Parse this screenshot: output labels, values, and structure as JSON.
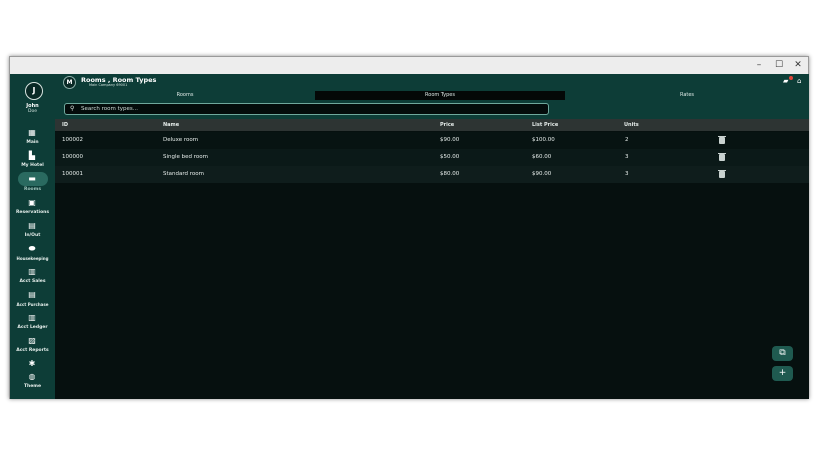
{
  "window": {
    "minimize": "–",
    "maximize": "☐",
    "close": "✕"
  },
  "user": {
    "initial": "J",
    "first_name": "John",
    "last_name": "Doe"
  },
  "nav": [
    {
      "label": "Main",
      "icon": "dashboard-icon",
      "glyph": "▦"
    },
    {
      "label": "My Hotel",
      "icon": "hotel-icon",
      "glyph": "▙"
    },
    {
      "label": "Rooms",
      "icon": "bed-icon",
      "glyph": "▬",
      "active": true
    },
    {
      "label": "Reservations",
      "icon": "calendar-icon",
      "glyph": "▣"
    },
    {
      "label": "In/Out",
      "icon": "luggage-icon",
      "glyph": "▤"
    },
    {
      "label": "Housekeeping",
      "icon": "housekeeping-icon",
      "glyph": "⬬"
    },
    {
      "label": "Acct Sales",
      "icon": "sales-icon",
      "glyph": "▥"
    },
    {
      "label": "Acct Purchase",
      "icon": "purchase-icon",
      "glyph": "▤"
    },
    {
      "label": "Acct Ledger",
      "icon": "bank-icon",
      "glyph": "▥"
    },
    {
      "label": "Acct Reports",
      "icon": "reports-icon",
      "glyph": "▨"
    },
    {
      "label": "",
      "icon": "gear-icon",
      "glyph": "✱"
    },
    {
      "label": "Theme",
      "icon": "palette-icon",
      "glyph": "◍"
    }
  ],
  "header": {
    "badge": "M",
    "title": "Rooms , Room Types",
    "subtitle": "Main Company 69001"
  },
  "tabs": [
    {
      "label": "Rooms"
    },
    {
      "label": "Room Types",
      "active": true
    },
    {
      "label": "Rates"
    }
  ],
  "search": {
    "placeholder": "Search room types..."
  },
  "table": {
    "columns": [
      "ID",
      "Name",
      "Price",
      "List Price",
      "Units"
    ],
    "rows": [
      {
        "id": "100002",
        "name": "Deluxe room",
        "price": "$90.00",
        "list_price": "$100.00",
        "units": "2"
      },
      {
        "id": "100000",
        "name": "Single bed room",
        "price": "$50.00",
        "list_price": "$60.00",
        "units": "3"
      },
      {
        "id": "100001",
        "name": "Standard room",
        "price": "$80.00",
        "list_price": "$90.00",
        "units": "3"
      }
    ]
  },
  "fab": {
    "copy": "⧉",
    "add": "+"
  },
  "colors": {
    "sidebar": "#0d3d37",
    "main_bg": "#06100f",
    "accent": "#1f5a50",
    "header_row": "#2d3433"
  }
}
